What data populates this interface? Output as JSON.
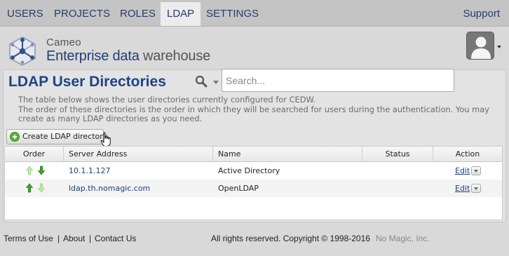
{
  "nav": {
    "items": [
      {
        "label": "USERS"
      },
      {
        "label": "PROJECTS"
      },
      {
        "label": "ROLES"
      },
      {
        "label": "LDAP",
        "active": true
      },
      {
        "label": "SETTINGS"
      }
    ],
    "support": "Support"
  },
  "brand": {
    "top": "Cameo",
    "enterprise": "Enterprise data",
    "warehouse": "warehouse",
    "logo_icon": "cameo-logo-icon",
    "avatar_icon": "user-avatar-icon"
  },
  "page": {
    "title": "LDAP User Directories",
    "search_icon": "search-icon",
    "search_placeholder": "Search...",
    "desc_line1": "The table below shows the user directories currently configured for CEDW.",
    "desc_line2": "The order of these directories is the order in which they will be searched for users during the authentication. You may create as many LDAP directories as you need.",
    "create_button": "Create LDAP directory"
  },
  "table": {
    "columns": [
      "Order",
      "Server Address",
      "Name",
      "Status",
      "Action"
    ],
    "rows": [
      {
        "address": "10.1.1.127",
        "name": "Active Directory",
        "status": "",
        "action": "Edit",
        "up_enabled": false,
        "down_enabled": true
      },
      {
        "address": "ldap.th.nomagic.com",
        "name": "OpenLDAP",
        "status": "",
        "action": "Edit",
        "up_enabled": true,
        "down_enabled": false
      }
    ]
  },
  "footer": {
    "terms": "Terms of Use",
    "about": "About",
    "contact": "Contact Us",
    "separator": "|",
    "copyright": "All rights reserved. Copyright © 1998-2016",
    "company": "No Magic, Inc."
  },
  "colors": {
    "accent": "#1f4387",
    "link": "#1f3e78",
    "arrow_enabled": "#3b9b2a",
    "arrow_disabled": "#a8dc9a"
  }
}
